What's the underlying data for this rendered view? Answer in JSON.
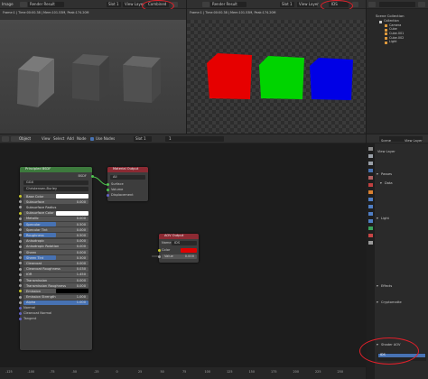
{
  "left_editor": {
    "type_menu": "Image",
    "image_name": "Render Result",
    "slot": "Slot 1",
    "view_layer": "View Layer",
    "pass": "Combined",
    "info": "Frame:1 | Time:00:00.38 | Mem:101.53M, Peak:174.20M",
    "cube_colors": [
      "#5c5c5c",
      "#4a4a4a",
      "#515151"
    ]
  },
  "right_editor": {
    "image_name": "Render Result",
    "slot": "Slot 1",
    "view_layer": "View Layer",
    "pass": "IDS",
    "info": "Frame:1 | Time:00:00.38 | Mem:101.53M, Peak:174.20M",
    "cube_colors": [
      "#e60000",
      "#00d400",
      "#0000e6"
    ]
  },
  "outliner": {
    "title": "Scene Collection",
    "items": [
      "Collection",
      "Camera",
      "Cube",
      "Cube.001",
      "Cube.002",
      "Light"
    ]
  },
  "node_editor": {
    "menus": [
      "Object",
      "View",
      "Select",
      "Add",
      "Node"
    ],
    "use_nodes": "Use Nodes",
    "slot": "Slot 1",
    "frame_num": "1"
  },
  "principled": {
    "title": "Principled BSDF",
    "output": "BSDF",
    "distribution": "GGX",
    "subsurface_method": "Christensen-Burley",
    "rows": [
      {
        "label": "Base Color",
        "value": "",
        "color": "#ffffff"
      },
      {
        "label": "Subsurface",
        "value": "0.000"
      },
      {
        "label": "Subsurface Radius",
        "value": ""
      },
      {
        "label": "Subsurface Color",
        "value": "",
        "color": "#ffffff"
      },
      {
        "label": "Metallic",
        "value": "0.000"
      },
      {
        "label": "Specular",
        "value": "0.500",
        "fill": 0.5
      },
      {
        "label": "Specular Tint",
        "value": "0.000"
      },
      {
        "label": "Roughness",
        "value": "0.500",
        "fill": 0.5
      },
      {
        "label": "Anisotropic",
        "value": "0.000"
      },
      {
        "label": "Anisotropic Rotation",
        "value": "0.000"
      },
      {
        "label": "Sheen",
        "value": "0.000"
      },
      {
        "label": "Sheen Tint",
        "value": "0.500",
        "fill": 0.5
      },
      {
        "label": "Clearcoat",
        "value": "0.000"
      },
      {
        "label": "Clearcoat Roughness",
        "value": "0.030"
      },
      {
        "label": "IOR",
        "value": "1.450"
      },
      {
        "label": "Transmission",
        "value": "0.000"
      },
      {
        "label": "Transmission Roughness",
        "value": "0.000"
      },
      {
        "label": "Emission",
        "value": "",
        "color": "#000000"
      },
      {
        "label": "Emission Strength",
        "value": "1.000"
      },
      {
        "label": "Alpha",
        "value": "1.000",
        "fill": 1.0
      }
    ],
    "tail": [
      "Normal",
      "Clearcoat Normal",
      "Tangent"
    ]
  },
  "material_output": {
    "title": "Material Output",
    "target": "All",
    "sockets": [
      "Surface",
      "Volume",
      "Displacement"
    ]
  },
  "aov_output": {
    "title": "AOV Output",
    "name_label": "Name",
    "name_value": "IDS",
    "color_label": "Color",
    "value_label": "Value",
    "value": "0.000",
    "color": "#e00000"
  },
  "ruler": [
    "-125",
    "-100",
    "-75",
    "-50",
    "-25",
    "0",
    "25",
    "50",
    "75",
    "100",
    "125",
    "150",
    "175",
    "200",
    "225",
    "250"
  ],
  "properties": {
    "scene": "Scene",
    "view_layer": "View Layer",
    "title": "View Layer",
    "panels": [
      "Passes",
      "Data",
      "Light",
      "Effects",
      "Cryptomatte",
      "Shader AOV"
    ],
    "aov_item": "IDS"
  }
}
